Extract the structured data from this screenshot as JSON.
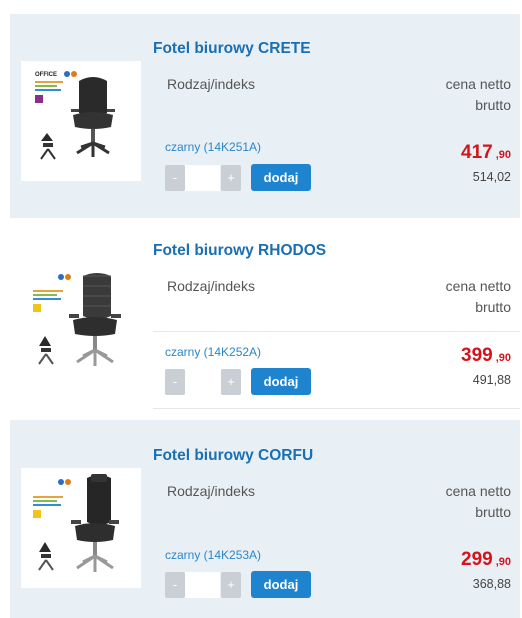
{
  "colors": {
    "accent": "#1e84d0",
    "title": "#1a6fb3",
    "price": "#d3141c",
    "shade": "#e9f0f5"
  },
  "products": [
    {
      "title": "Fotel biurowy CRETE",
      "label": "Rodzaj/indeks",
      "price_net_label": "cena netto",
      "price_gross_label": "brutto",
      "variant": "czarny (14K251A)",
      "minus": "-",
      "plus": "+",
      "add": "dodaj",
      "price_main": "417",
      "price_cents": ",90",
      "price_gross": "514,02",
      "image_brand": "OFFICE"
    },
    {
      "title": "Fotel biurowy RHODOS",
      "label": "Rodzaj/indeks",
      "price_net_label": "cena netto",
      "price_gross_label": "brutto",
      "variant": "czarny (14K252A)",
      "minus": "-",
      "plus": "+",
      "add": "dodaj",
      "price_main": "399",
      "price_cents": ",90",
      "price_gross": "491,88"
    },
    {
      "title": "Fotel biurowy CORFU",
      "label": "Rodzaj/indeks",
      "price_net_label": "cena netto",
      "price_gross_label": "brutto",
      "variant": "czarny (14K253A)",
      "minus": "-",
      "plus": "+",
      "add": "dodaj",
      "price_main": "299",
      "price_cents": ",90",
      "price_gross": "368,88"
    }
  ]
}
